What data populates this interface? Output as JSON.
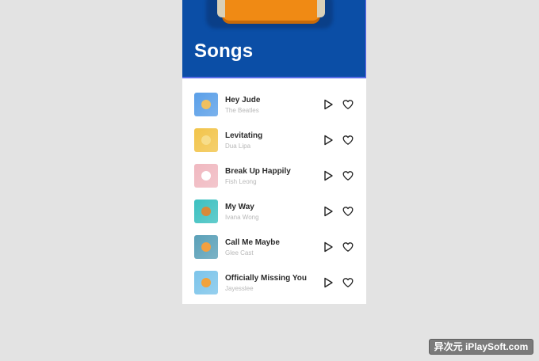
{
  "header": {
    "title": "Songs",
    "background_color": "#0b4ea6"
  },
  "songs": [
    {
      "title": "Hey Jude",
      "artist": "The Beatles",
      "thumb_color": "#5a9fe8",
      "accent_color": "#f0c060"
    },
    {
      "title": "Levitating",
      "artist": "Dua Lipa",
      "thumb_color": "#f2c44a",
      "accent_color": "#f7dd8a"
    },
    {
      "title": "Break Up Happily",
      "artist": "Fish Leong",
      "thumb_color": "#f0b8c0",
      "accent_color": "#ffffff"
    },
    {
      "title": "My Way",
      "artist": "Ivana Wong",
      "thumb_color": "#3cc0c0",
      "accent_color": "#d98a3a"
    },
    {
      "title": "Call Me Maybe",
      "artist": "Glee Cast",
      "thumb_color": "#5aa0b8",
      "accent_color": "#f3a040"
    },
    {
      "title": "Officially Missing You",
      "artist": "Jayesslee",
      "thumb_color": "#7cc4ea",
      "accent_color": "#f2a23a"
    }
  ],
  "icons": {
    "play": "play-icon",
    "like": "heart-icon"
  },
  "watermark": {
    "text": "异次元 iPlaySoft.com"
  }
}
